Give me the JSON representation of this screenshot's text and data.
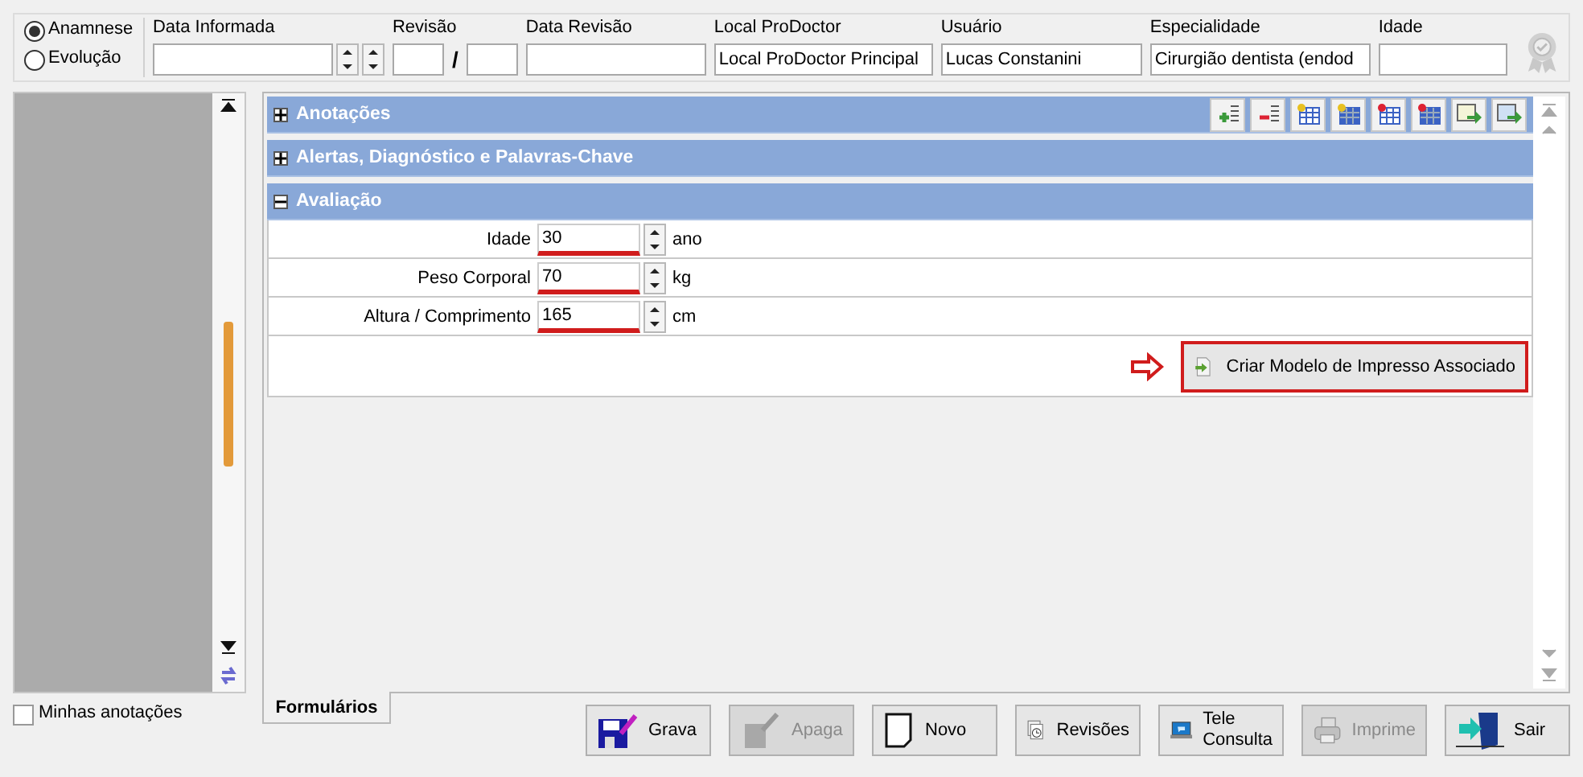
{
  "mode_options": [
    {
      "label": "Anamnese",
      "selected": true
    },
    {
      "label": "Evolução",
      "selected": false
    }
  ],
  "header_fields": [
    {
      "kind": "date",
      "label": "Data Informada"
    },
    {
      "kind": "revision",
      "label": "Revisão",
      "separator": "/"
    },
    {
      "kind": "text",
      "label": "Data Revisão"
    },
    {
      "kind": "text",
      "label": "Local ProDoctor",
      "value": "Local ProDoctor Principal"
    },
    {
      "kind": "text",
      "label": "Usuário",
      "value": "Lucas Constanini"
    },
    {
      "kind": "text",
      "label": "Especialidade",
      "value": "Cirurgião dentista (endod"
    },
    {
      "kind": "text",
      "label": "Idade"
    }
  ],
  "sections": [
    {
      "title": "Anotações",
      "expanded": false,
      "toolbar": true
    },
    {
      "title": "Alertas, Diagnóstico e Palavras-Chave",
      "expanded": false
    },
    {
      "title": "Avaliação",
      "expanded": true,
      "fields": [
        {
          "label": "Idade",
          "value": "30",
          "unit": "ano",
          "required": true
        },
        {
          "label": "Peso Corporal",
          "value": "70",
          "unit": "kg",
          "required": true
        },
        {
          "label": "Altura / Comprimento",
          "value": "165",
          "unit": "cm",
          "required": true
        }
      ],
      "action": {
        "label": "Criar Modelo de Impresso Associado",
        "highlighted": true
      }
    }
  ],
  "my_notes": {
    "label": "Minhas anotações",
    "checked": false
  },
  "tab": {
    "label": "Formulários",
    "selected": true
  },
  "buttons": [
    {
      "kind": "save",
      "label": "Grava",
      "disabled": false
    },
    {
      "kind": "delete",
      "label": "Apaga",
      "disabled": true
    },
    {
      "kind": "new",
      "label": "Novo",
      "disabled": false
    },
    {
      "kind": "revisions",
      "label": "Revisões",
      "disabled": false
    },
    {
      "kind": "tele",
      "label": "Tele\nConsulta",
      "disabled": false
    },
    {
      "kind": "print",
      "label": "Imprime",
      "disabled": true
    },
    {
      "kind": "exit",
      "label": "Sair",
      "disabled": false
    }
  ]
}
